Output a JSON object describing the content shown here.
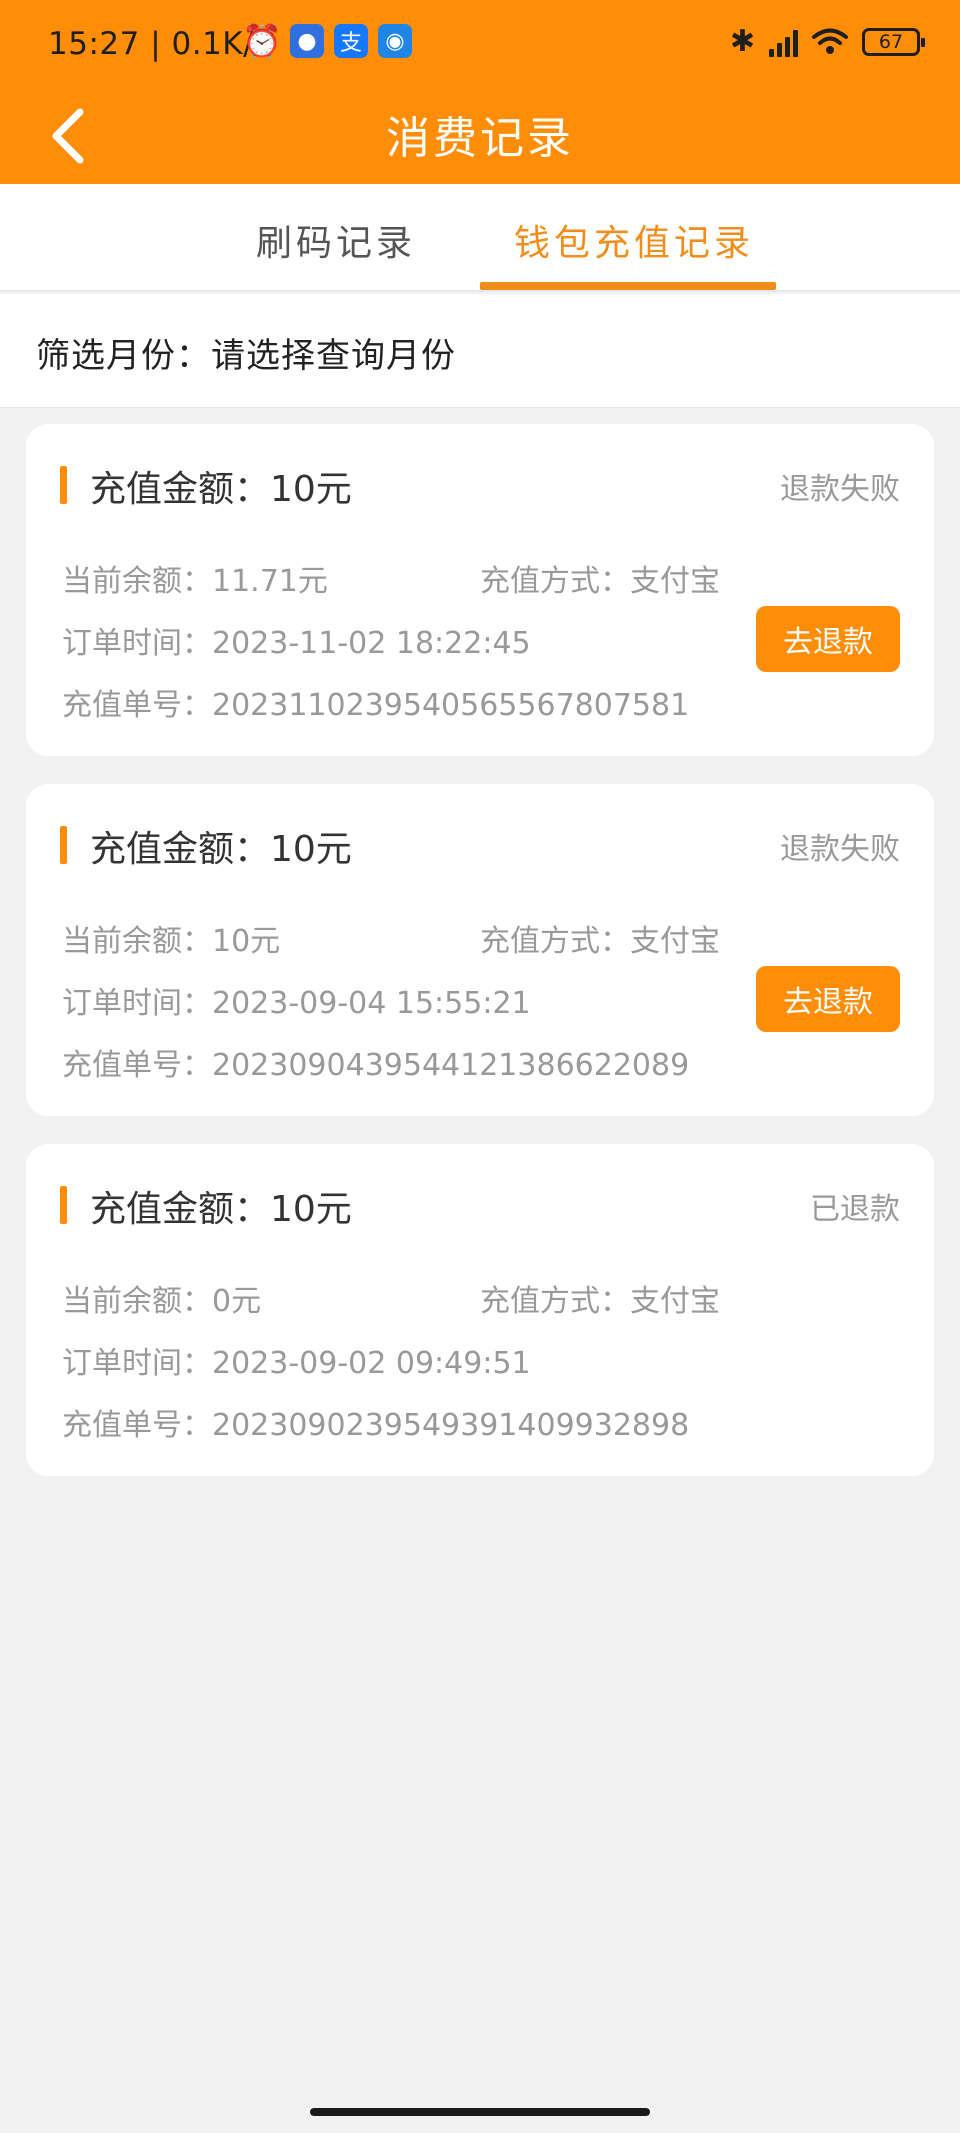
{
  "status_bar": {
    "time": "15:27 | 0.1K/s",
    "battery": "67",
    "alipay_glyph": "支"
  },
  "header": {
    "title": "消费记录"
  },
  "tabs": [
    {
      "label": "刷码记录",
      "active": false
    },
    {
      "label": "钱包充值记录",
      "active": true
    }
  ],
  "filter": {
    "label": "筛选月份：请选择查询月份"
  },
  "records": [
    {
      "amount": "充值金额：10元",
      "status": "退款失败",
      "balance": "当前余额：11.71元",
      "method": "充值方式：支付宝",
      "time": "订单时间：2023-11-02 18:22:45",
      "order_no": "充值单号：20231102395405655678075​81",
      "button": "去退款"
    },
    {
      "amount": "充值金额：10元",
      "status": "退款失败",
      "balance": "当前余额：10元",
      "method": "充值方式：支付宝",
      "time": "订单时间：2023-09-04 15:55:21",
      "order_no": "充值单号：20230904395441213866220​89",
      "button": "去退款"
    },
    {
      "amount": "充值金额：10元",
      "status": "已退款",
      "balance": "当前余额：0元",
      "method": "充值方式：支付宝",
      "time": "订单时间：2023-09-02 09:49:51",
      "order_no": "充值单号：20230902395493914099328​98",
      "button": null
    }
  ],
  "colors": {
    "brand": "#ff8d07",
    "active_tab": "#f18d1b",
    "background": "#f2f2f2"
  }
}
